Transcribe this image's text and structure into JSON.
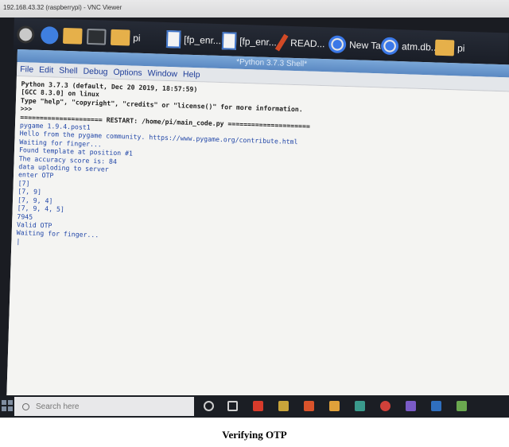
{
  "vnc": {
    "title": "192.168.43.32 (raspberrypi) - VNC Viewer"
  },
  "rpi_taskbar": {
    "items": [
      {
        "label": "",
        "icon": "raspberry-icon"
      },
      {
        "label": "",
        "icon": "globe-icon"
      },
      {
        "label": "",
        "icon": "folder-icon"
      },
      {
        "label": "",
        "icon": "terminal-icon"
      },
      {
        "label": "pi",
        "icon": "folder-icon"
      },
      {
        "label": "[fp_enr...",
        "icon": "python-doc-icon"
      },
      {
        "label": "[fp_enr...",
        "icon": "python-doc-icon"
      },
      {
        "label": "READ...",
        "icon": "pencil-icon"
      },
      {
        "label": "New Ta...",
        "icon": "chromium-icon"
      },
      {
        "label": "atm.db...",
        "icon": "chromium-icon"
      },
      {
        "label": "pi",
        "icon": "folder-icon"
      }
    ]
  },
  "shell": {
    "title": "*Python 3.7.3 Shell*",
    "menus": [
      "File",
      "Edit",
      "Shell",
      "Debug",
      "Options",
      "Window",
      "Help"
    ],
    "lines": [
      {
        "text": "Python 3.7.3 (default, Dec 20 2019, 18:57:59)",
        "kind": "sys"
      },
      {
        "text": "[GCC 8.3.0] on linux",
        "kind": "sys"
      },
      {
        "text": "Type \"help\", \"copyright\", \"credits\" or \"license()\" for more information.",
        "kind": "sys"
      },
      {
        "text": ">>>",
        "kind": "sys"
      },
      {
        "text": "===================== RESTART: /home/pi/main_code.py =====================",
        "kind": "sys"
      },
      {
        "text": "pygame 1.9.4.post1",
        "kind": "out"
      },
      {
        "text": "Hello from the pygame community. https://www.pygame.org/contribute.html",
        "kind": "out"
      },
      {
        "text": "Waiting for finger...",
        "kind": "out"
      },
      {
        "text": "Found template at position #1",
        "kind": "out"
      },
      {
        "text": "The accuracy score is: 84",
        "kind": "out"
      },
      {
        "text": "data uploding to server",
        "kind": "out"
      },
      {
        "text": "enter OTP",
        "kind": "out"
      },
      {
        "text": "[7]",
        "kind": "out"
      },
      {
        "text": "[7, 9]",
        "kind": "out"
      },
      {
        "text": "[7, 9, 4]",
        "kind": "out"
      },
      {
        "text": "[7, 9, 4, 5]",
        "kind": "out"
      },
      {
        "text": "7945",
        "kind": "out"
      },
      {
        "text": "Valid OTP",
        "kind": "out"
      },
      {
        "text": "Waiting for finger...",
        "kind": "out"
      },
      {
        "text": "|",
        "kind": "cursor"
      }
    ]
  },
  "windows_taskbar": {
    "search_placeholder": "Search here"
  },
  "caption": "Verifying OTP",
  "colors": {
    "shell_output": "#2247a8",
    "menu_text": "#1e3d99",
    "title_bar": "#5a88c2"
  }
}
